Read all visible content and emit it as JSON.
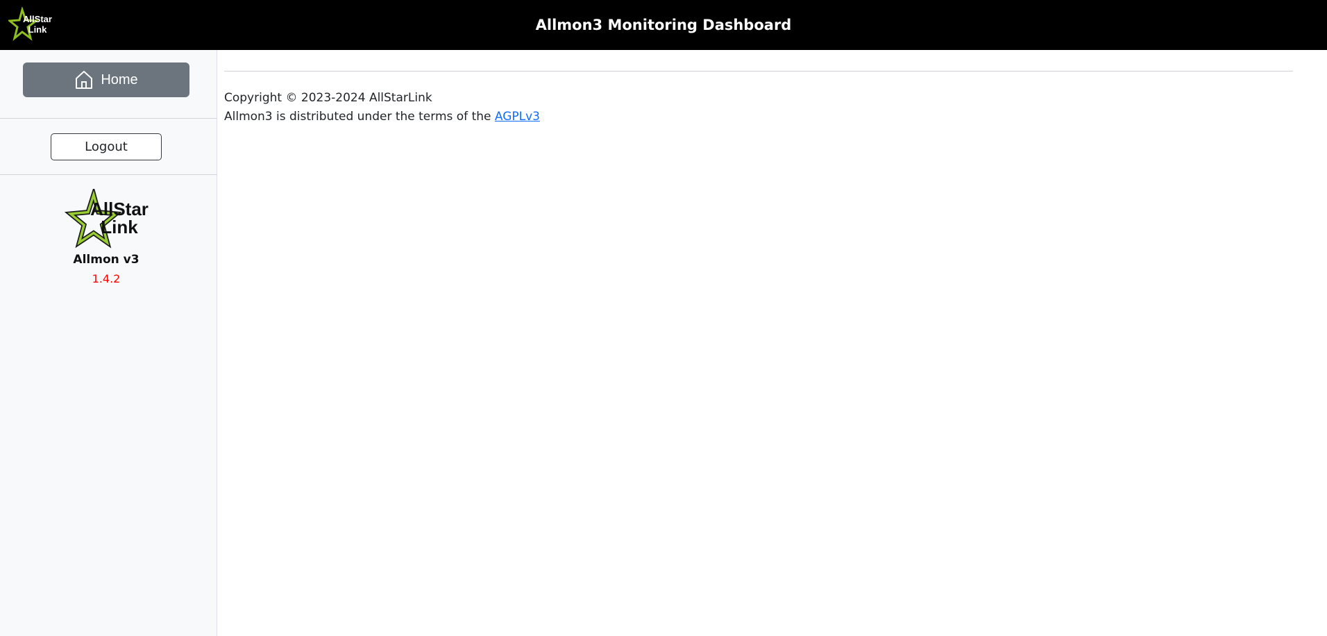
{
  "header": {
    "title": "Allmon3 Monitoring Dashboard",
    "logo_text": [
      "AllStar",
      "Link"
    ]
  },
  "sidebar": {
    "home_label": "Home",
    "logout_label": "Logout",
    "logo_text": [
      "AllStar",
      "Link"
    ],
    "app_name": "Allmon v3",
    "version": "1.4.2"
  },
  "footer": {
    "copyright": "Copyright © 2023-2024 AllStarLink",
    "license_prefix": "Allmon3 is distributed under the terms of the ",
    "license_link": "AGPLv3"
  },
  "colors": {
    "header_bg": "#000000",
    "home_button_bg": "#6c757d",
    "version_text": "#ff0000",
    "link": "#0d6efd",
    "logo_star": "#8fbf1f"
  }
}
